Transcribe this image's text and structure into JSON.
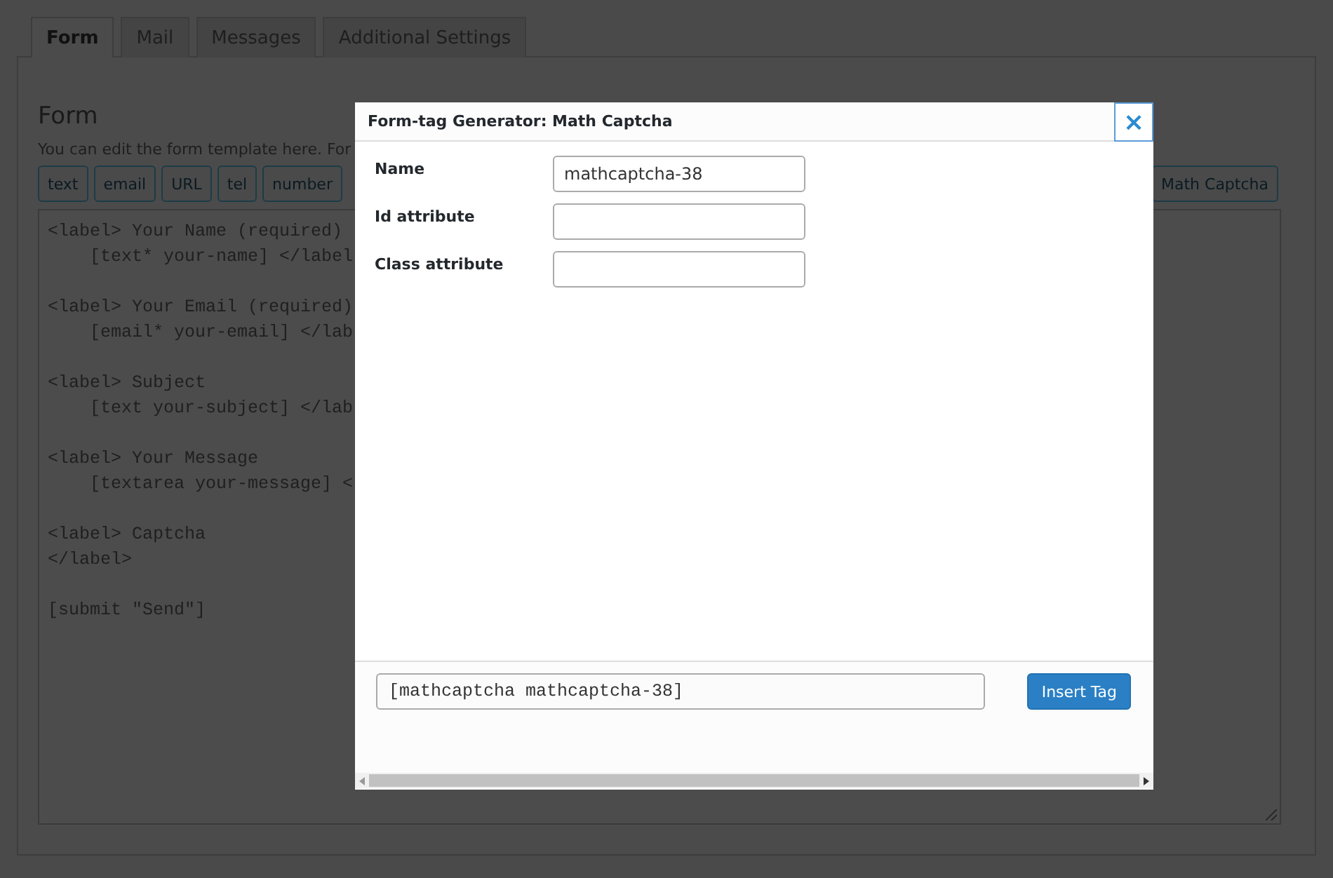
{
  "tabs": [
    {
      "label": "Form",
      "selected": true
    },
    {
      "label": "Mail",
      "selected": false
    },
    {
      "label": "Messages",
      "selected": false
    },
    {
      "label": "Additional Settings",
      "selected": false
    }
  ],
  "form_panel": {
    "heading": "Form",
    "description": "You can edit the form template here. For",
    "tag_buttons_left": [
      "text",
      "email",
      "URL",
      "tel",
      "number"
    ],
    "tag_buttons_right": [
      "Math Captcha"
    ],
    "code_blocks": [
      [
        "<label> Your Name (required)",
        "    [text* your-name] </label"
      ],
      [
        "<label> Your Email (required)",
        "    [email* your-email] </lab"
      ],
      [
        "<label> Subject",
        "    [text your-subject] </lab"
      ],
      [
        "<label> Your Message",
        "    [textarea your-message] <"
      ],
      [
        "<label> Captcha",
        "</label>"
      ],
      [
        "[submit \"Send\"]"
      ]
    ]
  },
  "dialog": {
    "title": "Form-tag Generator: Math Captcha",
    "close": "×",
    "fields": [
      {
        "label": "Name",
        "value": "mathcaptcha-38"
      },
      {
        "label": "Id attribute"
      },
      {
        "label": "Class attribute"
      }
    ],
    "tag_output": "[mathcaptcha mathcaptcha-38]",
    "insert_button": "Insert Tag"
  }
}
